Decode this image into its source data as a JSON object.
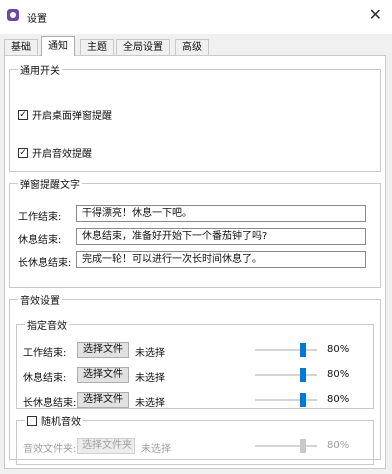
{
  "window": {
    "title": "设置",
    "close_glyph": "✕"
  },
  "tabs": [
    {
      "label": "基础"
    },
    {
      "label": "通知"
    },
    {
      "label": "主题"
    },
    {
      "label": "全局设置"
    },
    {
      "label": "高级"
    }
  ],
  "active_tab": "通知",
  "general": {
    "legend": "通用开关",
    "desktop_popup": {
      "label": "开启桌面弹窗提醒",
      "checked": true
    },
    "sound_reminder": {
      "label": "开启音效提醒",
      "checked": true
    }
  },
  "popup_text": {
    "legend": "弹窗提醒文字",
    "rows": [
      {
        "label": "工作结束:",
        "value": "干得漂亮！休息一下吧。"
      },
      {
        "label": "休息结束:",
        "value": "休息结束，准备好开始下一个番茄钟了吗?"
      },
      {
        "label": "长休息结束:",
        "value": "完成一轮！可以进行一次长时间休息了。"
      }
    ]
  },
  "sound": {
    "legend": "音效设置",
    "specified": {
      "legend": "指定音效",
      "rows": [
        {
          "label": "工作结束:",
          "button": "选择文件",
          "status": "未选择",
          "volume": 80,
          "volume_text": "80%"
        },
        {
          "label": "休息结束:",
          "button": "选择文件",
          "status": "未选择",
          "volume": 80,
          "volume_text": "80%"
        },
        {
          "label": "长休息结束:",
          "button": "选择文件",
          "status": "未选择",
          "volume": 80,
          "volume_text": "80%"
        }
      ]
    },
    "random": {
      "checkbox_label": "随机音效",
      "checked": false,
      "folder_label": "音效文件夹:",
      "button": "选择文件夹",
      "status": "未选择",
      "volume": 80,
      "volume_text": "80%"
    }
  },
  "colors": {
    "accent": "#0078d7",
    "disabled": "#a0a0a0"
  },
  "icons": {
    "app": "app-logo-icon",
    "check": "checkmark-icon",
    "close": "close-icon"
  }
}
